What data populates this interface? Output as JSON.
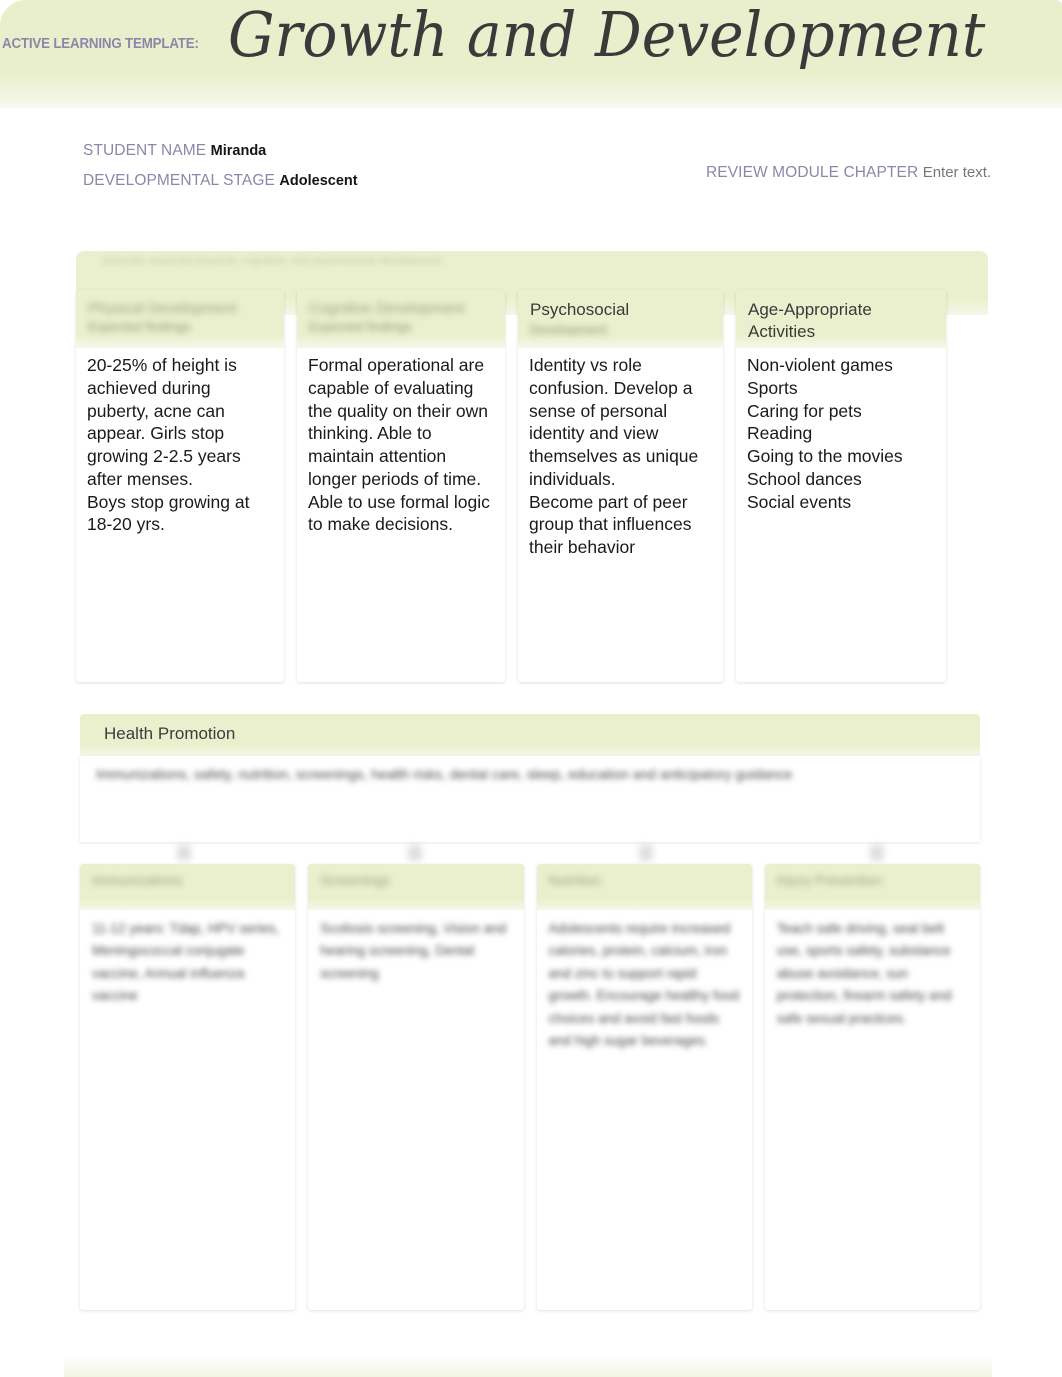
{
  "header": {
    "template_label": "ACTIVE LEARNING TEMPLATE:",
    "title": "Growth and Development"
  },
  "fields": {
    "student_name_label": "STUDENT NAME",
    "student_name_value": "Miranda",
    "developmental_stage_label": "DEVELOPMENTAL STAGE",
    "developmental_stage_value": "Adolescent",
    "review_module_label": "REVIEW MODULE CHAPTER",
    "review_module_value": "Enter text."
  },
  "section_one": {
    "band_title": "Describe expected physical, cognitive, and psychosocial development",
    "columns": [
      {
        "title": "Physical Development",
        "subtitle": "Expected findings",
        "title_blurred": true,
        "body": "20-25% of height is achieved during puberty, acne can appear. Girls stop growing 2-2.5 years after menses.\nBoys stop growing at 18-20 yrs."
      },
      {
        "title": "Cognitive Development",
        "subtitle": "Expected findings",
        "title_blurred": true,
        "body": "Formal operational are capable of evaluating the quality on their own thinking. Able to maintain attention longer periods of time. Able to use formal logic to make decisions."
      },
      {
        "title": "Psychosocial",
        "subtitle": "Development",
        "title_blurred": false,
        "body": "Identity vs role confusion. Develop a sense of personal identity and view themselves as unique individuals.\nBecome part of peer group that influences their behavior"
      },
      {
        "title": "Age-Appropriate Activities",
        "subtitle": "",
        "title_blurred": false,
        "body": "Non-violent games\nSports\nCaring for pets\nReading\nGoing to the movies\nSchool dances\nSocial events"
      }
    ]
  },
  "section_two": {
    "band_title": "Health Promotion",
    "body": "Immunizations, safety, nutrition, screenings, health risks, dental care, sleep, education and anticipatory guidance",
    "columns": [
      {
        "title": "Immunizations",
        "body": "11-12 years: Tdap, HPV series, Meningococcal conjugate vaccine, Annual influenza vaccine"
      },
      {
        "title": "Screenings",
        "body": "Scoliosis screening, Vision and hearing screening, Dental screening"
      },
      {
        "title": "Nutrition",
        "body": "Adolescents require increased calories, protein, calcium, iron and zinc to support rapid growth. Encourage healthy food choices and avoid fast foods and high sugar beverages."
      },
      {
        "title": "Injury Prevention",
        "body": "Teach safe driving, seat belt use, sports safety, substance abuse avoidance, sun protection, firearm safety and safe sexual practices."
      }
    ]
  }
}
